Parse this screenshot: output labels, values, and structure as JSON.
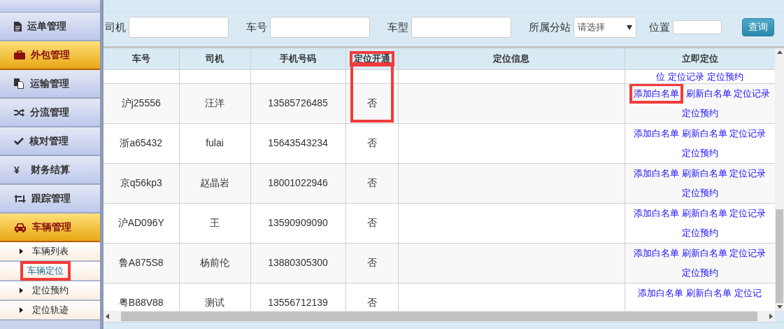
{
  "sidebar": {
    "items": [
      {
        "label": "运单管理",
        "active": false
      },
      {
        "label": "外包管理",
        "active": true
      },
      {
        "label": "运输管理",
        "active": false
      },
      {
        "label": "分流管理",
        "active": false
      },
      {
        "label": "核对管理",
        "active": false
      },
      {
        "label": "财务结算",
        "icon_text": "¥",
        "active": false
      },
      {
        "label": "跟踪管理",
        "active": false
      },
      {
        "label": "车辆管理",
        "active": true,
        "expanded": true,
        "children": [
          {
            "label": "车辆列表",
            "selected": false,
            "highlighted": false
          },
          {
            "label": "车辆定位",
            "selected": true,
            "highlighted": true
          },
          {
            "label": "定位预约",
            "selected": false,
            "highlighted": false
          },
          {
            "label": "定位轨迹",
            "selected": false,
            "highlighted": false
          }
        ]
      }
    ]
  },
  "search": {
    "fields": [
      {
        "label": "司机",
        "kind": "text"
      },
      {
        "label": "车号",
        "kind": "text"
      },
      {
        "label": "车型",
        "kind": "text"
      },
      {
        "label": "所属分站",
        "kind": "select",
        "value": "请选择"
      },
      {
        "label": "位置",
        "kind": "small"
      }
    ],
    "button": "查询"
  },
  "table": {
    "columns": [
      {
        "label": "车号",
        "highlighted": false
      },
      {
        "label": "司机",
        "highlighted": false
      },
      {
        "label": "手机号码",
        "highlighted": false
      },
      {
        "label": "定位开通",
        "highlighted": true
      },
      {
        "label": "定位信息",
        "highlighted": false
      },
      {
        "label": "立即定位",
        "highlighted": false
      }
    ],
    "rows": [
      {
        "partial": true,
        "cells": [
          "",
          "",
          "",
          "",
          ""
        ],
        "actions": [
          {
            "label": "位",
            "highlighted": false
          },
          {
            "label": "定位记录",
            "highlighted": false
          },
          {
            "label": "定位预约",
            "highlighted": false
          }
        ]
      },
      {
        "partial": false,
        "cells": [
          "沪j25556",
          "汪洋",
          "13585726485",
          "否",
          ""
        ],
        "open_highlighted": true,
        "actions": [
          {
            "label": "添加白名单",
            "highlighted": true
          },
          {
            "label": "刷新白名单",
            "highlighted": false
          },
          {
            "label": "定位记录",
            "highlighted": false
          },
          {
            "label": "定位预约",
            "highlighted": false
          }
        ]
      },
      {
        "partial": false,
        "open_highlighted": false,
        "cells": [
          "浙a65432",
          "fulai",
          "15643543234",
          "否",
          ""
        ],
        "actions": [
          {
            "label": "添加白名单",
            "highlighted": false
          },
          {
            "label": "刷新白名单",
            "highlighted": false
          },
          {
            "label": "定位记录",
            "highlighted": false
          },
          {
            "label": "定位预约",
            "highlighted": false
          }
        ]
      },
      {
        "partial": false,
        "open_highlighted": false,
        "cells": [
          "京q56kp3",
          "赵晶岩",
          "18001022946",
          "否",
          ""
        ],
        "actions": [
          {
            "label": "添加白名单",
            "highlighted": false
          },
          {
            "label": "刷新白名单",
            "highlighted": false
          },
          {
            "label": "定位记录",
            "highlighted": false
          },
          {
            "label": "定位预约",
            "highlighted": false
          }
        ]
      },
      {
        "partial": false,
        "open_highlighted": false,
        "cells": [
          "沪AD096Y",
          "王",
          "13590909090",
          "否",
          ""
        ],
        "actions": [
          {
            "label": "添加白名单",
            "highlighted": false
          },
          {
            "label": "刷新白名单",
            "highlighted": false
          },
          {
            "label": "定位记录",
            "highlighted": false
          },
          {
            "label": "定位预约",
            "highlighted": false
          }
        ]
      },
      {
        "partial": false,
        "open_highlighted": false,
        "cells": [
          "鲁A875S8",
          "杨前伦",
          "13880305300",
          "否",
          ""
        ],
        "actions": [
          {
            "label": "添加白名单",
            "highlighted": false
          },
          {
            "label": "刷新白名单",
            "highlighted": false
          },
          {
            "label": "定位记录",
            "highlighted": false
          },
          {
            "label": "定位预约",
            "highlighted": false
          }
        ]
      },
      {
        "partial": false,
        "open_highlighted": false,
        "cells": [
          "粤B88V88",
          "测试",
          "13556712139",
          "否",
          ""
        ],
        "actions": [
          {
            "label": "添加白名单",
            "highlighted": false
          },
          {
            "label": "刷新白名单",
            "highlighted": false
          },
          {
            "label": "定位记",
            "highlighted": false
          }
        ]
      }
    ]
  }
}
